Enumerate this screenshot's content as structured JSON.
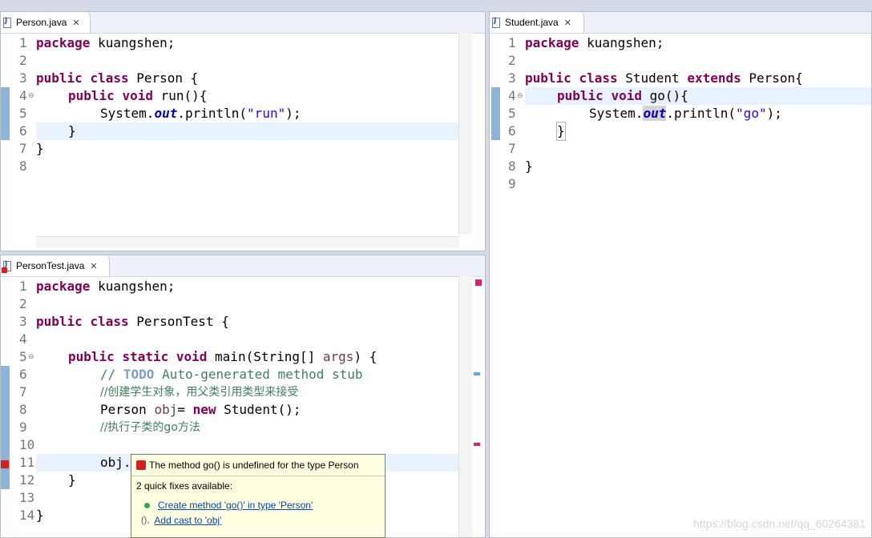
{
  "colors": {
    "keyword": "#7f0055",
    "string": "#2a00ff",
    "field": "#0000c0",
    "comment": "#3f7f5f",
    "line_highlight": "#e8f2fe"
  },
  "person_pane": {
    "tab_label": "Person.java",
    "close_icon": "close-icon",
    "line_numbers": [
      "1",
      "2",
      "3",
      "4",
      "5",
      "6",
      "7",
      "8"
    ],
    "code": {
      "l1_kw": "package",
      "l1_rest": " kuangshen;",
      "l3_kw1": "public",
      "l3_kw2": "class",
      "l3_rest": " Person {",
      "l4_kw1": "public",
      "l4_kw2": "void",
      "l4_rest": " run(){",
      "l5_pre": "System.",
      "l5_field": "out",
      "l5_mid": ".println(",
      "l5_str": "\"run\"",
      "l5_end": ");",
      "l6": "}",
      "l7": "}"
    }
  },
  "student_pane": {
    "tab_label": "Student.java",
    "line_numbers": [
      "1",
      "2",
      "3",
      "4",
      "5",
      "6",
      "7",
      "8",
      "9"
    ],
    "code": {
      "l1_kw": "package",
      "l1_rest": " kuangshen;",
      "l3_kw1": "public",
      "l3_kw2": "class",
      "l3_mid": " Student ",
      "l3_kw3": "extends",
      "l3_rest": " Person{",
      "l4_kw1": "public",
      "l4_kw2": "void",
      "l4_rest": " go(){",
      "l5_pre": "System.",
      "l5_field": "out",
      "l5_mid": ".println(",
      "l5_str": "\"go\"",
      "l5_end": ");",
      "l6": "}",
      "l8": "}"
    }
  },
  "persontest_pane": {
    "tab_label": "PersonTest.java",
    "line_numbers": [
      "1",
      "2",
      "3",
      "4",
      "5",
      "6",
      "7",
      "8",
      "9",
      "10",
      "11",
      "12",
      "13",
      "14"
    ],
    "code": {
      "l1_kw": "package",
      "l1_rest": " kuangshen;",
      "l3_kw1": "public",
      "l3_kw2": "class",
      "l3_rest": " PersonTest {",
      "l5_kw1": "public",
      "l5_kw2": "static",
      "l5_kw3": "void",
      "l5_mid": " main(String[] ",
      "l5_var": "args",
      "l5_end": ") {",
      "l6_pre": "// ",
      "l6_todo": "TODO",
      "l6_rest": " Auto-generated method stub",
      "l7": "//创建学生对象，用父类引用类型来接受",
      "l8_pre": "Person ",
      "l8_var": "obj",
      "l8_mid": "= ",
      "l8_kw": "new",
      "l8_rest": " Student();",
      "l9": "//执行子类的go方法",
      "l10": "obj.go();",
      "l11": "}",
      "l13": "}"
    }
  },
  "quickfix": {
    "title": "The method go() is undefined for the type Person",
    "count_text": "2 quick fixes available:",
    "fix1": "Create method 'go()' in type 'Person'",
    "fix2": "Add cast to 'obj'"
  },
  "watermark": "https://blog.csdn.net/qq_60264381"
}
